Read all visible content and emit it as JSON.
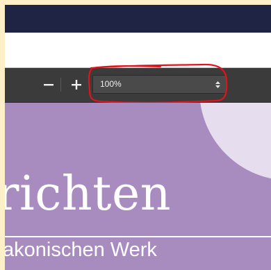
{
  "toolbar": {
    "zoom_out_icon": "minus-icon",
    "zoom_in_icon": "plus-icon",
    "zoom_level": "100%",
    "zoom_select_icon": "up-down-arrows-icon",
    "highlight_color": "#e0141c"
  },
  "document": {
    "heading": "richten",
    "subheading": "akonischen Werk",
    "background_color": "#a88bbf",
    "circle_color": "#e6ddee"
  },
  "colors": {
    "title_bar": "#1f2444",
    "toolbar": "#3b3b3b",
    "frame": "#fdf0c8"
  }
}
